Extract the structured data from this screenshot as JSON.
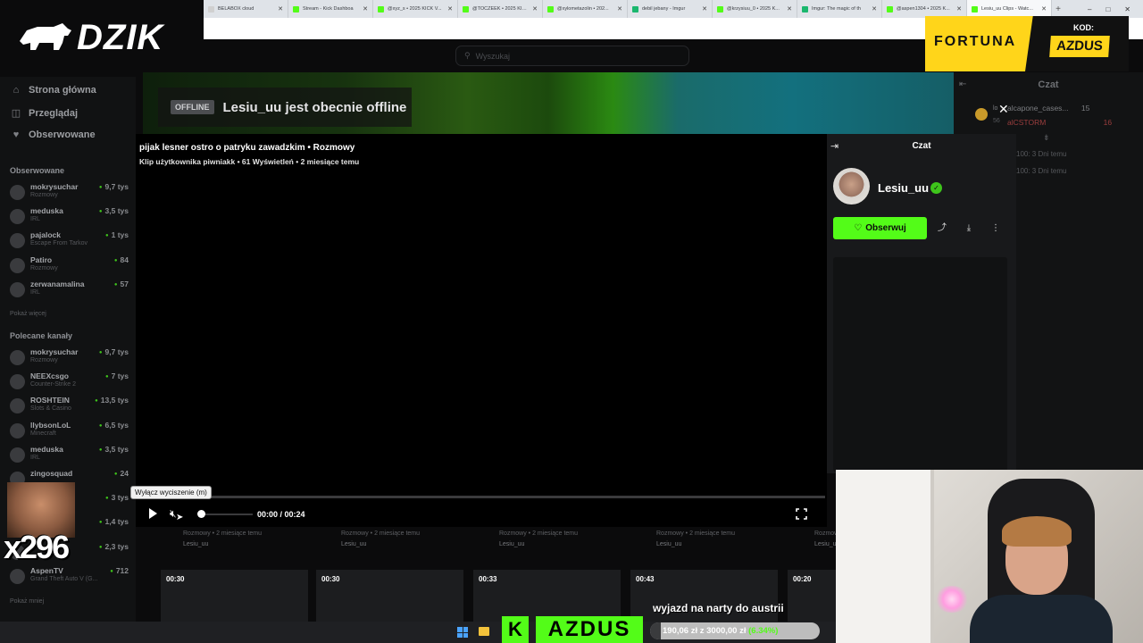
{
  "browser": {
    "tabs": [
      {
        "label": "BELABOX cloud",
        "color": "#d0d0d0",
        "active": false
      },
      {
        "label": "Stream - Kick Dashboa",
        "color": "#53fc18",
        "active": false
      },
      {
        "label": "@xyz_s • 2025 KICK V...",
        "color": "#53fc18",
        "active": false
      },
      {
        "label": "@TOCZEEK • 2025 KIC...",
        "color": "#53fc18",
        "active": false
      },
      {
        "label": "@xylometazolin • 202...",
        "color": "#53fc18",
        "active": false
      },
      {
        "label": "debil jebany - Imgur",
        "color": "#1bb76e",
        "active": false
      },
      {
        "label": "@krzysiuu_0 • 2025 K...",
        "color": "#53fc18",
        "active": false
      },
      {
        "label": "Imgur: The magic of th",
        "color": "#1bb76e",
        "active": false
      },
      {
        "label": "@aspen1304 • 2025 K...",
        "color": "#53fc18",
        "active": false
      },
      {
        "label": "Lesiu_uu Clips - Watc...",
        "color": "#53fc18",
        "active": true
      }
    ],
    "new_tab": "+",
    "controls": [
      "–",
      "□",
      "✕"
    ]
  },
  "logo": {
    "text": "DZIK"
  },
  "search": {
    "placeholder": "Wyszukaj"
  },
  "sidebar": {
    "nav": [
      {
        "label": "Strona główna",
        "icon": "home-icon",
        "glyph": "⌂"
      },
      {
        "label": "Przeglądaj",
        "icon": "browse-icon",
        "glyph": "◫"
      },
      {
        "label": "Obserwowane",
        "icon": "heart-icon",
        "glyph": "♥"
      }
    ],
    "followed_title": "Obserwowane",
    "followed": [
      {
        "name": "mokrysuchar",
        "cat": "Rozmowy",
        "viewers": "9,7 tys"
      },
      {
        "name": "meduska",
        "cat": "IRL",
        "viewers": "3,5 tys"
      },
      {
        "name": "pajalock",
        "cat": "Escape From Tarkov",
        "viewers": "1 tys"
      },
      {
        "name": "Patiro",
        "cat": "Rozmowy",
        "viewers": "84"
      },
      {
        "name": "zerwanamalina",
        "cat": "IRL",
        "viewers": "57"
      }
    ],
    "followed_more": "Pokaż więcej",
    "recommended_title": "Polecane kanały",
    "recommended": [
      {
        "name": "mokrysuchar",
        "cat": "Rozmowy",
        "viewers": "9,7 tys"
      },
      {
        "name": "NEEXcsgo",
        "cat": "Counter-Strike 2",
        "viewers": "7 tys"
      },
      {
        "name": "ROSHTEIN",
        "cat": "Slots & Casino",
        "viewers": "13,5 tys"
      },
      {
        "name": "llybsonLoL",
        "cat": "Minecraft",
        "viewers": "6,5 tys"
      },
      {
        "name": "meduska",
        "cat": "IRL",
        "viewers": "3,5 tys"
      },
      {
        "name": "zingosquad",
        "cat": "",
        "viewers": "24"
      },
      {
        "name": "",
        "cat": "",
        "viewers": "3 tys"
      },
      {
        "name": "",
        "cat": "",
        "viewers": "1,4 tys"
      },
      {
        "name": "",
        "cat": "",
        "viewers": "2,3 tys"
      },
      {
        "name": "AspenTV",
        "cat": "Grand Theft Auto V (G...",
        "viewers": "712"
      }
    ],
    "recommended_more": "Pokaż mniej"
  },
  "banner": {
    "badge": "OFFLINE",
    "text": "Lesiu_uu jest obecnie offline"
  },
  "bg_chat": {
    "title": "Czat",
    "pinned": [
      {
        "text": "alcapone_cases...",
        "count": "15"
      },
      {
        "text": "alCSTORM",
        "count": "16"
      }
    ],
    "user_lines": [
      "lo",
      "56"
    ],
    "rows": [
      "100: 3 Dni temu",
      "100: 3 Dni temu"
    ]
  },
  "ad": {
    "brand": "FORTUNA",
    "kod_label": "KOD:",
    "code": "AZDUS"
  },
  "clip": {
    "title": "pijak lesner ostro o patryku zawadzkim • Rozmowy",
    "meta": "Klip użytkownika piwniakk • 61 Wyświetleń • 2 miesiące temu",
    "time": "00:00 / 00:24",
    "progress": 0,
    "volume": 0,
    "tooltip": "Wyłącz wyciszenie (m)"
  },
  "clip_panel": {
    "title": "Czat",
    "username": "Lesiu_uu",
    "verified_glyph": "✓",
    "follow_label": "Obserwuj",
    "follow_glyph": "♡",
    "share_glyph": "⤴",
    "download_glyph": "⤓",
    "more_glyph": "⋮"
  },
  "clip_list": [
    {
      "meta": "Rozmowy • 2 miesiące temu",
      "user": "Lesiu_uu"
    },
    {
      "meta": "Rozmowy • 2 miesiące temu",
      "user": "Lesiu_uu"
    },
    {
      "meta": "Rozmowy • 2 miesiące temu",
      "user": "Lesiu_uu"
    },
    {
      "meta": "Rozmowy • 2 miesiące temu",
      "user": "Lesiu_uu"
    },
    {
      "meta": "Rozmowy",
      "user": "Lesiu_uu"
    }
  ],
  "thumbs": [
    {
      "duration": "00:30"
    },
    {
      "duration": "00:30"
    },
    {
      "duration": "00:33"
    },
    {
      "duration": "00:43"
    },
    {
      "duration": "00:20"
    }
  ],
  "overlay": {
    "counter": "x296",
    "kick_letter": "K",
    "code": "AZDUS",
    "ticker": "wyjazd na narty do austrii",
    "goal_current": "190,06 zł",
    "goal_sep": "z",
    "goal_target": "3000,00 zł",
    "goal_pct": "(6.34%)",
    "goal_fraction": 0.0634
  },
  "colors": {
    "accent": "#53fc18",
    "panel": "#18191b",
    "sidebar": "#111213"
  }
}
